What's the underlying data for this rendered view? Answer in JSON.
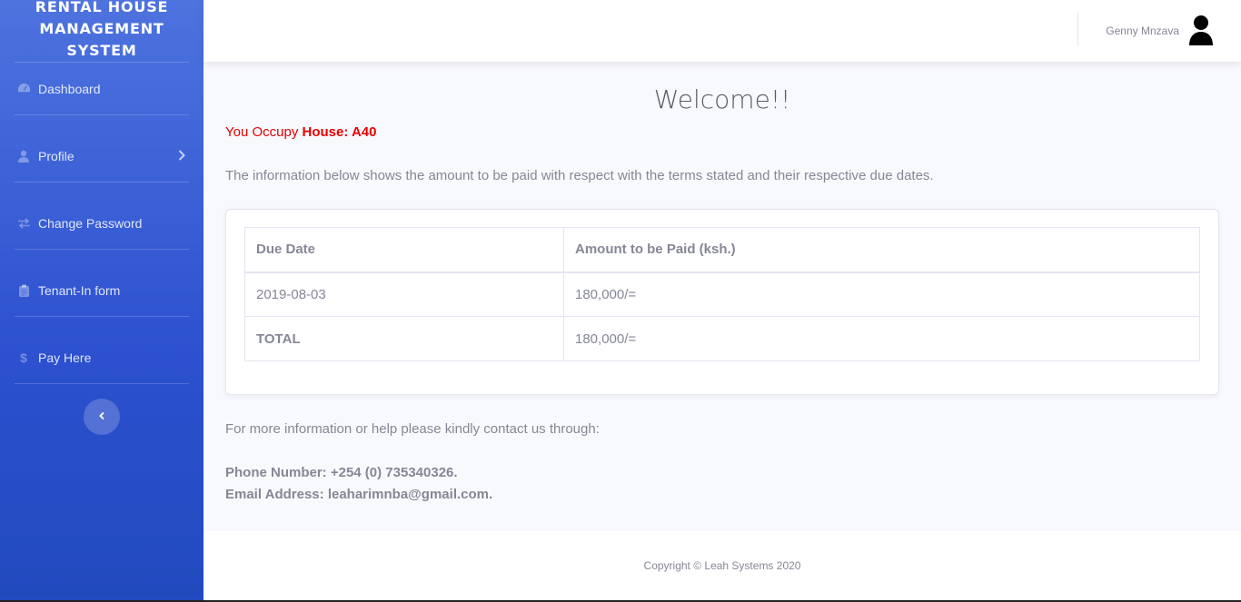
{
  "brand": {
    "title": "RENTAL HOUSE MANAGEMENT SYSTEM"
  },
  "sidebar": {
    "items": [
      {
        "label": "Dashboard",
        "icon": "tachometer-icon"
      },
      {
        "label": "Profile",
        "icon": "user-icon",
        "has_submenu": true
      },
      {
        "label": "Change Password",
        "icon": "exchange-icon"
      },
      {
        "label": "Tenant-In form",
        "icon": "clipboard-icon"
      },
      {
        "label": "Pay Here",
        "icon": "dollar-icon"
      }
    ],
    "toggle_icon": "chevron-left-icon"
  },
  "topbar": {
    "user_name": "Genny Mnzava",
    "avatar_icon": "user-avatar-icon"
  },
  "main": {
    "heading": "Welcome!!",
    "occupy_prefix": "You Occupy",
    "occupy_house": "House: A40",
    "info_text": "The information below shows the amount to be paid with respect with the terms stated and their respective due dates.",
    "table": {
      "headers": [
        "Due Date",
        "Amount to be Paid (ksh.)"
      ],
      "rows": [
        [
          "2019-08-03",
          "180,000/="
        ],
        [
          "TOTAL",
          "180,000/="
        ]
      ]
    },
    "help_text": "For more information or help please kindly contact us through:",
    "phone": "Phone Number: +254 (0) 735340326.",
    "email": "Email Address: leaharimnba@gmail.com."
  },
  "footer": {
    "copyright": "Copyright © Leah Systems 2020"
  },
  "colors": {
    "sidebar": "#4e73df",
    "occupy": "#e60000",
    "text": "#858796"
  }
}
